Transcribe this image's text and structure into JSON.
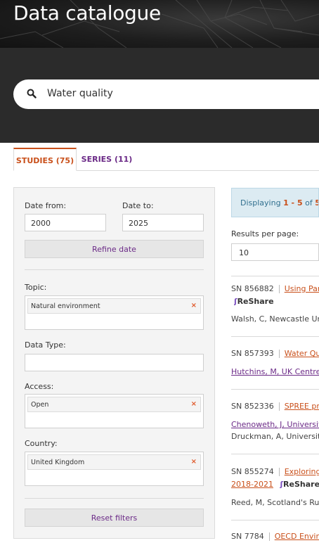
{
  "header": {
    "title": "Data catalogue"
  },
  "search": {
    "value": "Water quality"
  },
  "tabs": [
    {
      "label": "STUDIES (75)",
      "active": true
    },
    {
      "label": "SERIES (11)",
      "active": false
    }
  ],
  "filters": {
    "date_from_label": "Date from:",
    "date_from_value": "2000",
    "date_to_label": "Date to:",
    "date_to_value": "2025",
    "refine_label": "Refine date",
    "topic_label": "Topic:",
    "topic_tag": "Natural environment",
    "datatype_label": "Data Type:",
    "access_label": "Access:",
    "access_tag": "Open",
    "country_label": "Country:",
    "country_tag": "United Kingdom",
    "remove_symbol": "×",
    "reset_label": "Reset filters"
  },
  "results": {
    "info_prefix": "Displaying ",
    "info_range": "1 - 5",
    "info_mid": " of ",
    "info_total": "5",
    "info_suffix": " re",
    "per_page_label": "Results per page:",
    "per_page_value": "10",
    "reshare_label": "ReShare",
    "items": [
      {
        "sn": "SN 856882",
        "title": "Using Par",
        "author": "Walsh, C, Newcastle Uni"
      },
      {
        "sn": "SN 857393",
        "title": "Water Qu",
        "author": "Hutchins, M, UK Centre f"
      },
      {
        "sn": "SN 852336",
        "title": "SPREE pro",
        "author": "Chenoweth, J, University",
        "author2": "Druckman, A, University"
      },
      {
        "sn": "SN 855274",
        "title": "Exploring",
        "title2": "2018-2021",
        "author": "Reed, M, Scotland's Rura"
      },
      {
        "sn": "SN 7784",
        "title": "OECD Enviro"
      }
    ]
  },
  "colors": {
    "accent": "#c9501b",
    "link": "#6b2a87",
    "info_bg": "#dcebf2"
  }
}
